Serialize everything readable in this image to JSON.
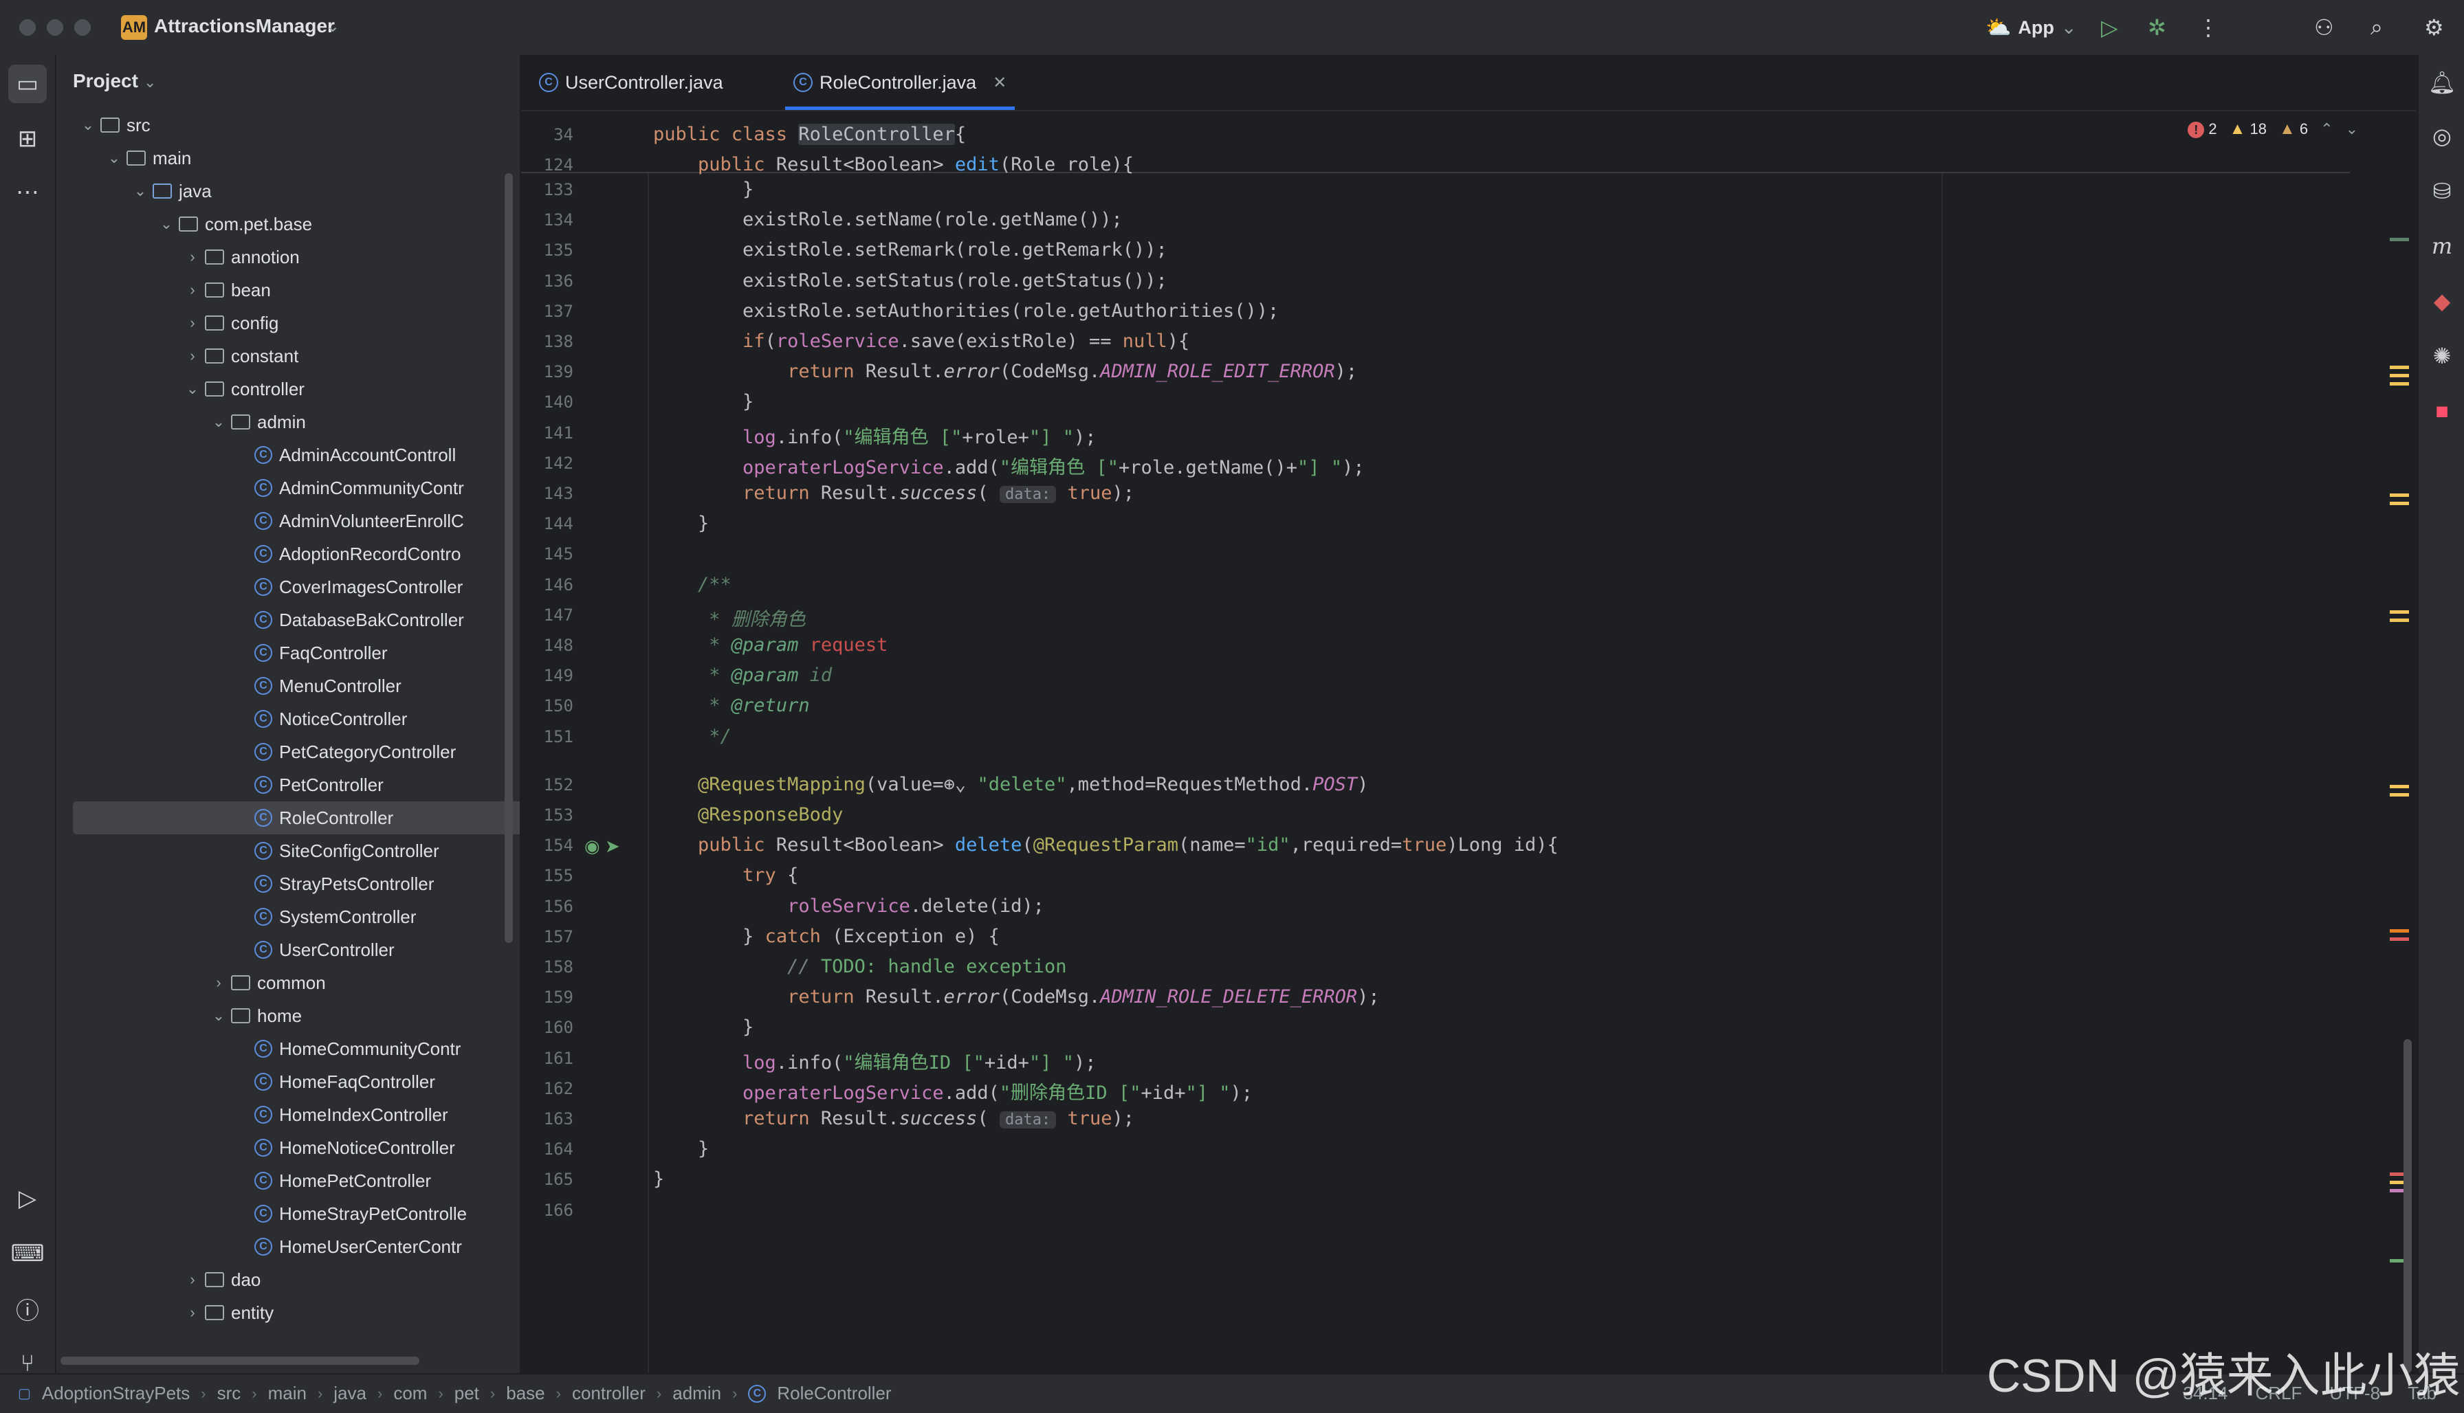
{
  "titlebar": {
    "app_badge": "AM",
    "app_name": "AttractionsManager",
    "run_config": "App"
  },
  "project_panel": {
    "title": "Project",
    "tree": [
      {
        "label": "src",
        "kind": "folder",
        "depth": 1,
        "arrow": "open"
      },
      {
        "label": "main",
        "kind": "folder",
        "depth": 2,
        "arrow": "open"
      },
      {
        "label": "java",
        "kind": "src-folder",
        "depth": 3,
        "arrow": "open"
      },
      {
        "label": "com.pet.base",
        "kind": "package",
        "depth": 4,
        "arrow": "open"
      },
      {
        "label": "annotion",
        "kind": "package",
        "depth": 5,
        "arrow": "closed"
      },
      {
        "label": "bean",
        "kind": "package",
        "depth": 5,
        "arrow": "closed"
      },
      {
        "label": "config",
        "kind": "package",
        "depth": 5,
        "arrow": "closed"
      },
      {
        "label": "constant",
        "kind": "package",
        "depth": 5,
        "arrow": "closed"
      },
      {
        "label": "controller",
        "kind": "package",
        "depth": 5,
        "arrow": "open"
      },
      {
        "label": "admin",
        "kind": "package",
        "depth": 6,
        "arrow": "open"
      },
      {
        "label": "AdminAccountControll",
        "kind": "class",
        "depth": 7
      },
      {
        "label": "AdminCommunityContr",
        "kind": "class",
        "depth": 7
      },
      {
        "label": "AdminVolunteerEnrollC",
        "kind": "class",
        "depth": 7
      },
      {
        "label": "AdoptionRecordContro",
        "kind": "class",
        "depth": 7
      },
      {
        "label": "CoverImagesController",
        "kind": "class",
        "depth": 7
      },
      {
        "label": "DatabaseBakController",
        "kind": "class",
        "depth": 7
      },
      {
        "label": "FaqController",
        "kind": "class",
        "depth": 7
      },
      {
        "label": "MenuController",
        "kind": "class",
        "depth": 7
      },
      {
        "label": "NoticeController",
        "kind": "class",
        "depth": 7
      },
      {
        "label": "PetCategoryController",
        "kind": "class",
        "depth": 7
      },
      {
        "label": "PetController",
        "kind": "class",
        "depth": 7
      },
      {
        "label": "RoleController",
        "kind": "class",
        "depth": 7,
        "selected": true
      },
      {
        "label": "SiteConfigController",
        "kind": "class",
        "depth": 7
      },
      {
        "label": "StrayPetsController",
        "kind": "class",
        "depth": 7
      },
      {
        "label": "SystemController",
        "kind": "class",
        "depth": 7
      },
      {
        "label": "UserController",
        "kind": "class",
        "depth": 7
      },
      {
        "label": "common",
        "kind": "package",
        "depth": 6,
        "arrow": "closed"
      },
      {
        "label": "home",
        "kind": "package",
        "depth": 6,
        "arrow": "open"
      },
      {
        "label": "HomeCommunityContr",
        "kind": "class",
        "depth": 7
      },
      {
        "label": "HomeFaqController",
        "kind": "class",
        "depth": 7
      },
      {
        "label": "HomeIndexController",
        "kind": "class",
        "depth": 7
      },
      {
        "label": "HomeNoticeController",
        "kind": "class",
        "depth": 7
      },
      {
        "label": "HomePetController",
        "kind": "class",
        "depth": 7
      },
      {
        "label": "HomeStrayPetControlle",
        "kind": "class",
        "depth": 7
      },
      {
        "label": "HomeUserCenterContr",
        "kind": "class",
        "depth": 7
      },
      {
        "label": "dao",
        "kind": "package",
        "depth": 5,
        "arrow": "closed"
      },
      {
        "label": "entity",
        "kind": "package",
        "depth": 5,
        "arrow": "closed"
      }
    ]
  },
  "editor": {
    "tabs": [
      {
        "label": "UserController.java",
        "active": false
      },
      {
        "label": "RoleController.java",
        "active": true
      }
    ],
    "inspections": {
      "errors": "2",
      "warnings": "18",
      "weak_warnings": "6"
    },
    "sticky_lines": [
      {
        "n": "34",
        "tokens": [
          [
            "kw",
            "public class "
          ],
          [
            "hlbox",
            "RoleController"
          ],
          [
            "",
            "{"
          ]
        ]
      },
      {
        "n": "124",
        "tokens": [
          [
            "kw",
            "    public "
          ],
          [
            "",
            "Result<Boolean> "
          ],
          [
            "fn",
            "edit"
          ],
          [
            "",
            "(Role role){"
          ]
        ]
      }
    ],
    "lines": [
      {
        "n": "133",
        "tokens": [
          [
            "",
            "        }"
          ]
        ]
      },
      {
        "n": "134",
        "tokens": [
          [
            "",
            "        existRole.setName(role.getName());"
          ]
        ]
      },
      {
        "n": "135",
        "tokens": [
          [
            "",
            "        existRole.setRemark(role.getRemark());"
          ]
        ]
      },
      {
        "n": "136",
        "tokens": [
          [
            "",
            "        existRole.setStatus(role.getStatus());"
          ]
        ]
      },
      {
        "n": "137",
        "tokens": [
          [
            "",
            "        existRole.setAuthorities(role.getAuthorities());"
          ]
        ]
      },
      {
        "n": "138",
        "tokens": [
          [
            "kw",
            "        if"
          ],
          [
            "",
            "("
          ],
          [
            "fld",
            "roleService"
          ],
          [
            "",
            ".save(existRole) == "
          ],
          [
            "kw",
            "null"
          ],
          [
            "",
            "){"
          ]
        ]
      },
      {
        "n": "139",
        "tokens": [
          [
            "kw",
            "            return "
          ],
          [
            "",
            "Result."
          ],
          [
            "it",
            "error"
          ],
          [
            "",
            "(CodeMsg."
          ],
          [
            "cst",
            "ADMIN_ROLE_EDIT_ERROR"
          ],
          [
            "",
            ");"
          ]
        ]
      },
      {
        "n": "140",
        "tokens": [
          [
            "",
            "        }"
          ]
        ]
      },
      {
        "n": "141",
        "tokens": [
          [
            "fld",
            "        log"
          ],
          [
            "",
            "."
          ],
          [
            "",
            "info"
          ],
          [
            "",
            "("
          ],
          [
            "str",
            "\"编辑角色 [\""
          ],
          [
            "",
            "+role+"
          ],
          [
            "str",
            "\"] \""
          ],
          [
            "",
            ");"
          ]
        ]
      },
      {
        "n": "142",
        "tokens": [
          [
            "fld",
            "        operaterLogService"
          ],
          [
            "",
            ".add("
          ],
          [
            "str",
            "\"编辑角色 [\""
          ],
          [
            "",
            "+role.getName()+"
          ],
          [
            "str",
            "\"] \""
          ],
          [
            "",
            ");"
          ]
        ]
      },
      {
        "n": "143",
        "tokens": [
          [
            "kw",
            "        return "
          ],
          [
            "",
            "Result."
          ],
          [
            "it",
            "success"
          ],
          [
            "",
            "( "
          ],
          [
            "hint",
            "data:"
          ],
          [
            "kw",
            " true"
          ],
          [
            "",
            ");"
          ]
        ]
      },
      {
        "n": "144",
        "tokens": [
          [
            "",
            "    }"
          ]
        ]
      },
      {
        "n": "145",
        "tokens": [
          [
            "",
            ""
          ]
        ]
      },
      {
        "n": "146",
        "tokens": [
          [
            "doc",
            "    /**"
          ]
        ]
      },
      {
        "n": "147",
        "tokens": [
          [
            "doc",
            "     * 删除角色"
          ]
        ]
      },
      {
        "n": "148",
        "tokens": [
          [
            "doc",
            "     * "
          ],
          [
            "tag",
            "@param "
          ],
          [
            "red",
            "request"
          ]
        ]
      },
      {
        "n": "149",
        "tokens": [
          [
            "doc",
            "     * "
          ],
          [
            "tag",
            "@param "
          ],
          [
            "doc",
            "id"
          ]
        ]
      },
      {
        "n": "150",
        "tokens": [
          [
            "doc",
            "     * "
          ],
          [
            "tag",
            "@return"
          ]
        ]
      },
      {
        "n": "151",
        "tokens": [
          [
            "doc",
            "     */"
          ]
        ]
      },
      {
        "n": "152",
        "tokens": [
          [
            "ann",
            "    @RequestMapping"
          ],
          [
            "",
            "(value="
          ],
          [
            "",
            "⊕⌄ "
          ],
          [
            "str",
            "\"delete\""
          ],
          [
            "",
            ",method=RequestMethod."
          ],
          [
            "inl",
            "POST"
          ],
          [
            "",
            ")"
          ]
        ]
      },
      {
        "n": "153",
        "tokens": [
          [
            "ann",
            "    @ResponseBody"
          ]
        ]
      },
      {
        "n": "154",
        "tokens": [
          [
            "kw",
            "    public "
          ],
          [
            "",
            "Result<Boolean> "
          ],
          [
            "fn",
            "delete"
          ],
          [
            "",
            "("
          ],
          [
            "ann",
            "@RequestParam"
          ],
          [
            "",
            "(name="
          ],
          [
            "str",
            "\"id\""
          ],
          [
            "",
            ",required="
          ],
          [
            "kw",
            "true"
          ],
          [
            "",
            ")Long id){"
          ]
        ]
      },
      {
        "n": "155",
        "tokens": [
          [
            "kw",
            "        try "
          ],
          [
            "",
            "{"
          ]
        ]
      },
      {
        "n": "156",
        "tokens": [
          [
            "fld",
            "            roleService"
          ],
          [
            "",
            ".delete(id);"
          ]
        ]
      },
      {
        "n": "157",
        "tokens": [
          [
            "",
            "        } "
          ],
          [
            "kw",
            "catch "
          ],
          [
            "",
            "(Exception e) {"
          ]
        ]
      },
      {
        "n": "158",
        "tokens": [
          [
            "cm",
            "            // "
          ],
          [
            "str",
            "TODO: handle exception"
          ]
        ]
      },
      {
        "n": "159",
        "tokens": [
          [
            "kw",
            "            return "
          ],
          [
            "",
            "Result."
          ],
          [
            "it",
            "error"
          ],
          [
            "",
            "(CodeMsg."
          ],
          [
            "cst",
            "ADMIN_ROLE_DELETE_ERROR"
          ],
          [
            "",
            ");"
          ]
        ]
      },
      {
        "n": "160",
        "tokens": [
          [
            "",
            "        }"
          ]
        ]
      },
      {
        "n": "161",
        "tokens": [
          [
            "fld",
            "        log"
          ],
          [
            "",
            ".info("
          ],
          [
            "str",
            "\"编辑角色ID [\""
          ],
          [
            "",
            "+id+"
          ],
          [
            "str",
            "\"] \""
          ],
          [
            "",
            ");"
          ]
        ]
      },
      {
        "n": "162",
        "tokens": [
          [
            "fld",
            "        operaterLogService"
          ],
          [
            "",
            ".add("
          ],
          [
            "str",
            "\"删除角色ID [\""
          ],
          [
            "",
            "+id+"
          ],
          [
            "str",
            "\"] \""
          ],
          [
            "",
            ");"
          ]
        ]
      },
      {
        "n": "163",
        "tokens": [
          [
            "kw",
            "        return "
          ],
          [
            "",
            "Result."
          ],
          [
            "it",
            "success"
          ],
          [
            "",
            "( "
          ],
          [
            "hint",
            "data:"
          ],
          [
            "kw",
            " true"
          ],
          [
            "",
            ");"
          ]
        ]
      },
      {
        "n": "164",
        "tokens": [
          [
            "",
            "    }"
          ]
        ]
      },
      {
        "n": "165",
        "tokens": [
          [
            "",
            "}"
          ]
        ]
      },
      {
        "n": "166",
        "tokens": [
          [
            "",
            ""
          ]
        ]
      }
    ]
  },
  "statusbar": {
    "breadcrumbs": [
      "AdoptionStrayPets",
      "src",
      "main",
      "java",
      "com",
      "pet",
      "base",
      "controller",
      "admin",
      "RoleController"
    ],
    "position": "34:14",
    "line_ending": "CRLF",
    "encoding": "UTF-8",
    "indent": "Tab"
  },
  "watermark": "CSDN @猿来入此小猿",
  "colors": {
    "accent": "#3574f0",
    "error": "#db5c5c",
    "warning": "#f2c55c"
  }
}
